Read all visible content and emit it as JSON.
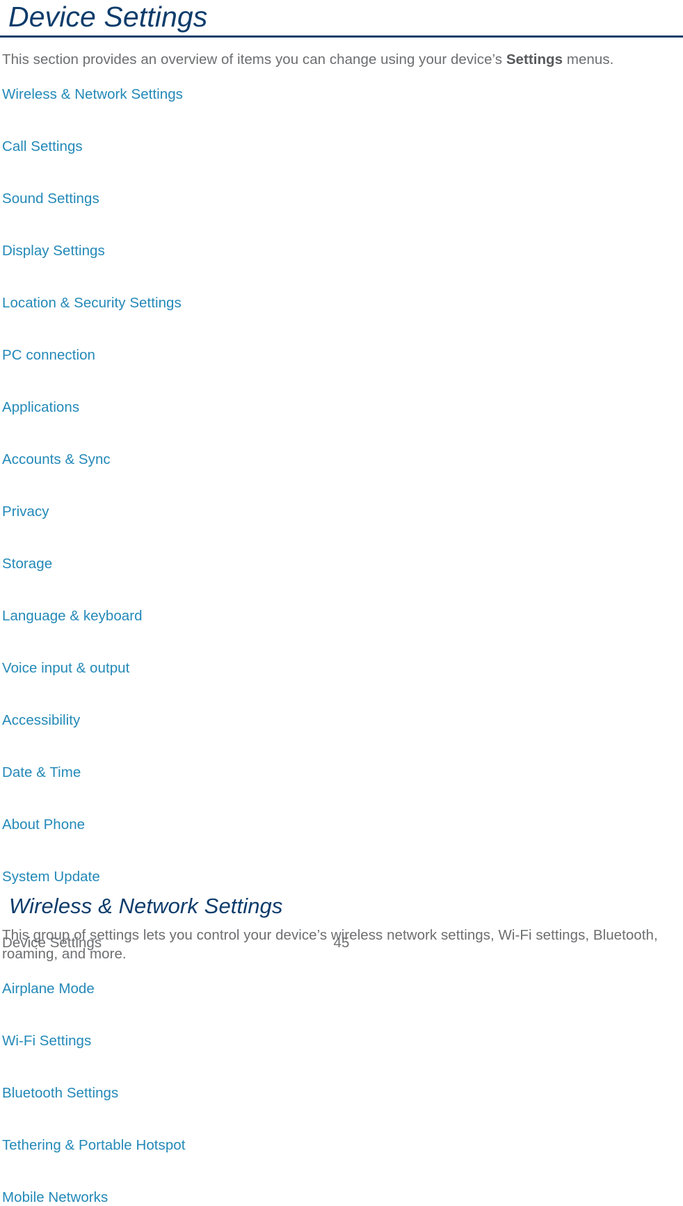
{
  "document": {
    "title": "Device Settings",
    "intro_paragraph": {
      "before": "This section provides an overview of items you can change using your device’s ",
      "bold": "Settings",
      "after": " menus."
    }
  },
  "toc_links": [
    {
      "label": "Wireless & Network Settings"
    },
    {
      "label": "Call Settings"
    },
    {
      "label": "Sound Settings"
    },
    {
      "label": "Display Settings"
    },
    {
      "label": "Location & Security Settings"
    },
    {
      "label": "PC connection"
    },
    {
      "label": "Applications"
    },
    {
      "label": "Accounts & Sync"
    },
    {
      "label": "Privacy"
    },
    {
      "label": "Storage"
    },
    {
      "label": "Language & keyboard"
    },
    {
      "label": "Voice input & output"
    },
    {
      "label": "Accessibility"
    },
    {
      "label": "Date & Time"
    },
    {
      "label": "About Phone"
    },
    {
      "label": "System Update"
    }
  ],
  "section": {
    "heading": "Wireless & Network Settings",
    "paragraph": "This group of settings lets you control your device’s wireless network settings, Wi-Fi settings, Bluetooth, roaming, and more.",
    "links": [
      {
        "label": "Airplane Mode"
      },
      {
        "label": "Wi-Fi Settings"
      },
      {
        "label": "Bluetooth Settings"
      },
      {
        "label": "Tethering & Portable Hotspot"
      },
      {
        "label": "Mobile Networks"
      }
    ]
  },
  "footer": {
    "left_text": "Device Settings",
    "page_number": "45"
  },
  "colors": {
    "heading_navy": "#0d3c6b",
    "link_teal": "#2389b8",
    "body_gray": "#6d6e70",
    "rule_navy": "#0d3c6b"
  }
}
